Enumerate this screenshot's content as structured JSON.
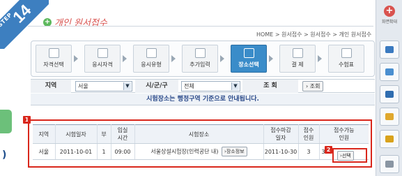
{
  "step_badge": {
    "label": "STEP",
    "number": "14"
  },
  "page_title": "개인 원서접수",
  "breadcrumb": "HOME > 원서접수 > 원서접수 > 개인 원서접수",
  "steps": [
    {
      "label": "자격선택",
      "icon": "certificate-icon",
      "active": false
    },
    {
      "label": "응시자격",
      "icon": "person-icon",
      "active": false
    },
    {
      "label": "응시유형",
      "icon": "form-icon",
      "active": false
    },
    {
      "label": "추가입력",
      "icon": "edit-icon",
      "active": false
    },
    {
      "label": "장소선택",
      "icon": "building-icon",
      "active": true
    },
    {
      "label": "결 제",
      "icon": "calculator-icon",
      "active": false
    },
    {
      "label": "수험표",
      "icon": "ticket-icon",
      "active": false
    }
  ],
  "filter": {
    "region_label": "지역",
    "region_value": "서울",
    "city_label": "시/군/구",
    "city_value": "전체",
    "search_label": "조 회",
    "search_button": "조회"
  },
  "notice": "시험장소는 행정구역 기준으로 안내됩니다.",
  "annotations": {
    "table_badge": "1",
    "select_badge": "2"
  },
  "table": {
    "headers": [
      "지역",
      "시험일자",
      "부",
      "입실\n시간",
      "시험장소",
      "접수마감\n일자",
      "접수\n인원",
      "접수가능\n인원"
    ],
    "rows": [
      {
        "region": "서울",
        "date": "2011-10-01",
        "session": "1",
        "time": "09:00",
        "place": "서울상설시험장(인력공단 내)",
        "place_button": "장소정보",
        "deadline": "2011-10-30",
        "applicants": "3",
        "available": "37",
        "select_button": "선택"
      }
    ]
  },
  "rail": {
    "top_label": "화면확대"
  },
  "colors": {
    "accent": "#3a8cc9",
    "highlight": "#d9271c",
    "title": "#d9534f"
  }
}
